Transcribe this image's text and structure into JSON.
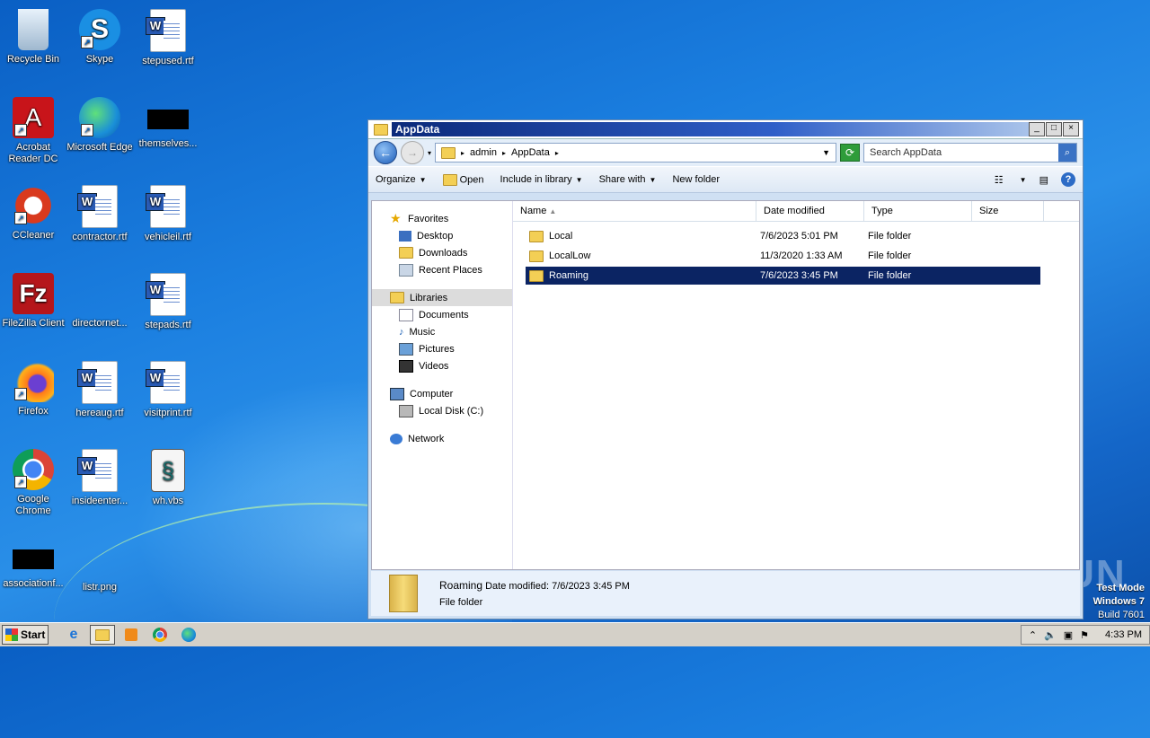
{
  "desktop": {
    "icons": [
      {
        "label": "Recycle Bin"
      },
      {
        "label": "Skype"
      },
      {
        "label": "stepused.rtf"
      },
      {
        "label": "Acrobat Reader DC"
      },
      {
        "label": "Microsoft Edge"
      },
      {
        "label": "themselves..."
      },
      {
        "label": "CCleaner"
      },
      {
        "label": "contractor.rtf"
      },
      {
        "label": "vehicleil.rtf"
      },
      {
        "label": "FileZilla Client"
      },
      {
        "label": "directornet..."
      },
      {
        "label": "stepads.rtf"
      },
      {
        "label": "Firefox"
      },
      {
        "label": "hereaug.rtf"
      },
      {
        "label": "visitprint.rtf"
      },
      {
        "label": "Google Chrome"
      },
      {
        "label": "insideenter..."
      },
      {
        "label": "wh.vbs"
      },
      {
        "label": "associationf..."
      },
      {
        "label": "listr.png"
      }
    ]
  },
  "window": {
    "title": "AppData",
    "address": {
      "crumbs": [
        "admin",
        "AppData"
      ]
    },
    "search_placeholder": "Search AppData",
    "toolbar": {
      "organize": "Organize",
      "open": "Open",
      "include": "Include in library",
      "share": "Share with",
      "newfolder": "New folder"
    },
    "nav": {
      "favorites": "Favorites",
      "desktop": "Desktop",
      "downloads": "Downloads",
      "recent": "Recent Places",
      "libraries": "Libraries",
      "documents": "Documents",
      "music": "Music",
      "pictures": "Pictures",
      "videos": "Videos",
      "computer": "Computer",
      "localdisk": "Local Disk (C:)",
      "network": "Network"
    },
    "columns": {
      "name": "Name",
      "date": "Date modified",
      "type": "Type",
      "size": "Size"
    },
    "files": [
      {
        "name": "Local",
        "date": "7/6/2023 5:01 PM",
        "type": "File folder"
      },
      {
        "name": "LocalLow",
        "date": "11/3/2020 1:33 AM",
        "type": "File folder"
      },
      {
        "name": "Roaming",
        "date": "7/6/2023 3:45 PM",
        "type": "File folder"
      }
    ],
    "details": {
      "name": "Roaming",
      "date_label": "Date modified:",
      "date": "7/6/2023 3:45 PM",
      "type": "File folder"
    }
  },
  "watermark": "ANY RUN",
  "testmode": {
    "line1": "Test Mode",
    "line2": "Windows 7",
    "line3": "Build 7601"
  },
  "taskbar": {
    "start": "Start",
    "clock": "4:33 PM"
  }
}
